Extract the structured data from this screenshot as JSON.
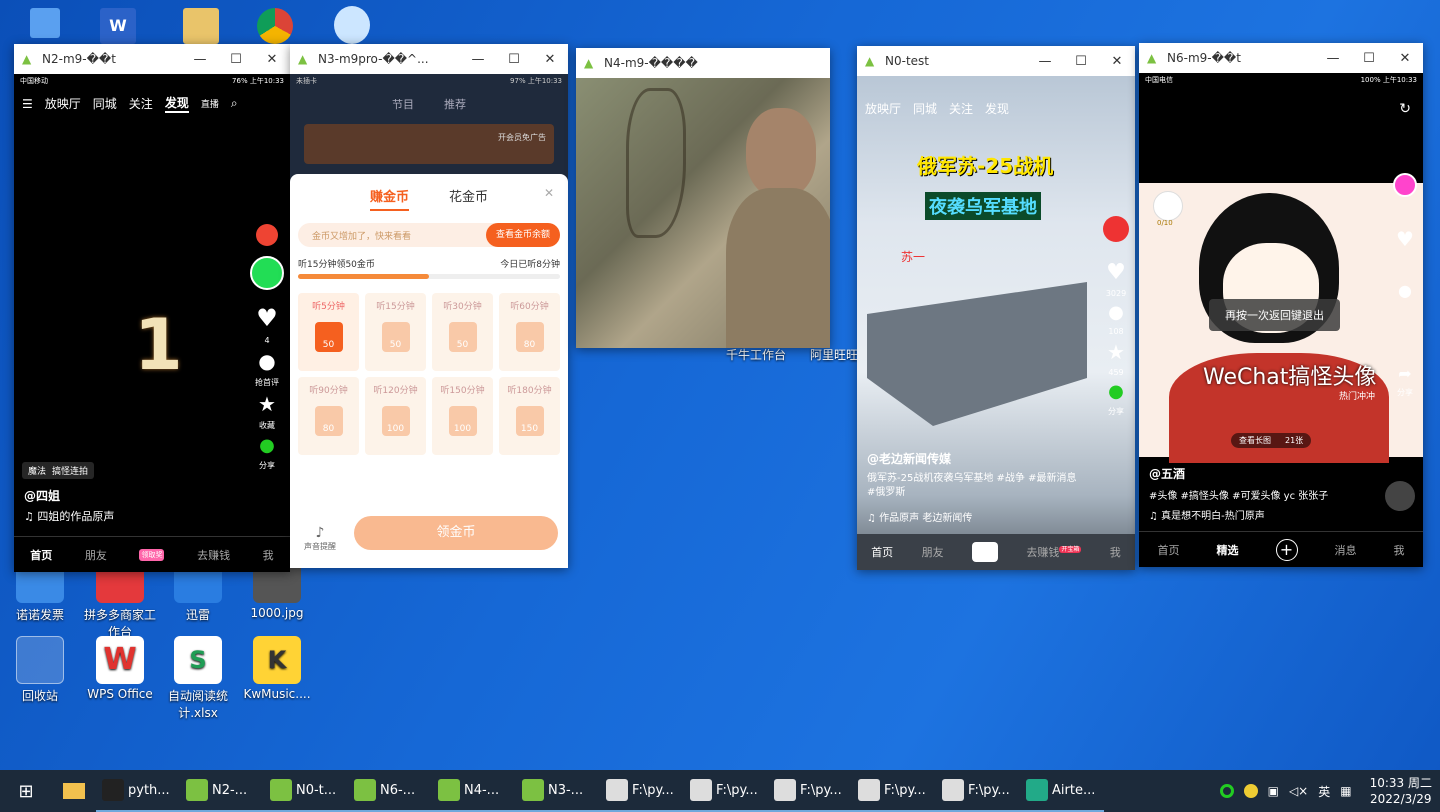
{
  "desktop": {
    "icons": [
      {
        "label": "诺诺发票"
      },
      {
        "label": "拼多多商家工作台"
      },
      {
        "label": "迅雷"
      },
      {
        "label": "1000.jpg"
      },
      {
        "label": "回收站"
      },
      {
        "label": "WPS Office"
      },
      {
        "label": "自动阅读统计.xlsx"
      },
      {
        "label": "KwMusic...."
      },
      {
        "label": "千牛工作台"
      },
      {
        "label": "阿里旺旺"
      }
    ]
  },
  "windows": {
    "n2": {
      "title": "N2-m9-��t",
      "status_left": "中国移动",
      "status_right": "76% 上午10:33",
      "nav": [
        "放映厅",
        "同城",
        "关注",
        "发现"
      ],
      "nav_live": "直播",
      "big_number": "1",
      "like_count": "4",
      "comment_label": "抢首评",
      "fav_label": "收藏",
      "share_label": "分享",
      "tag1": "魔法",
      "tag2": "搞怪连拍",
      "author": "@四姐",
      "music": "四姐的作品原声",
      "bottom_nav": [
        "首页",
        "朋友",
        "去赚钱",
        "我"
      ],
      "badge": "领取奖"
    },
    "n3": {
      "title": "N3-m9pro-��^...",
      "status_left": "未插卡",
      "status_right": "97% 上午10:33",
      "tabs": [
        "节目",
        "推荐"
      ],
      "ad_text": "开会员免广告",
      "sheet_tabs": [
        "赚金币",
        "花金币"
      ],
      "banner_text": "金币又增加了，快来看看",
      "banner_btn": "查看金币余额",
      "progress_left": "听15分钟领50金币",
      "progress_right": "今日已听8分钟",
      "progress_value": 0.5,
      "cells": [
        {
          "label": "听5分钟",
          "value": "50",
          "active": true
        },
        {
          "label": "听15分钟",
          "value": "50",
          "active": false
        },
        {
          "label": "听30分钟",
          "value": "50",
          "active": false
        },
        {
          "label": "听60分钟",
          "value": "80",
          "active": false
        },
        {
          "label": "听90分钟",
          "value": "80",
          "active": false
        },
        {
          "label": "听120分钟",
          "value": "100",
          "active": false
        },
        {
          "label": "听150分钟",
          "value": "100",
          "active": false
        },
        {
          "label": "听180分钟",
          "value": "150",
          "active": false
        }
      ],
      "remind_label": "声音提醒",
      "claim_btn": "领金币"
    },
    "n4": {
      "title": "N4-m9-����"
    },
    "n0": {
      "title": "N0-test",
      "nav": [
        "放映厅",
        "同城",
        "关注",
        "发现"
      ],
      "headline1": "俄军苏-25战机",
      "headline2": "夜袭乌军基地",
      "side_text": "苏一",
      "like_count": "3029",
      "comment_count": "108",
      "fav_count": "459",
      "share_label": "分享",
      "author": "@老边新闻传媒",
      "desc": "俄军苏-25战机夜袭乌军基地 #战争 #最新消息 #俄罗斯",
      "music": "作品原声   老边新闻传",
      "bottom_nav": [
        "首页",
        "朋友",
        "去赚钱",
        "我"
      ],
      "badge": "开宝箱"
    },
    "n6": {
      "title": "N6-m9-��t",
      "status_left": "中国电信",
      "status_right": "100% 上午10:33",
      "coin_text": "0/10",
      "toast": "再按一次返回键退出",
      "overlay": "WeChat搞怪头像",
      "overlay_sub": "热门冲冲",
      "longimg": "查看长图",
      "img_count": "21张",
      "share_label": "分享",
      "author": "@五酒",
      "desc": "#头像 #搞怪头像 #可爱头像 yc 张张子",
      "music": "真是想不明白-热门原声",
      "bottom_nav": [
        "首页",
        "精选",
        "消息",
        "我"
      ]
    }
  },
  "taskbar": {
    "items": [
      "pyth...",
      "N2-...",
      "N0-t...",
      "N6-...",
      "N4-...",
      "N3-...",
      "F:\\py...",
      "F:\\py...",
      "F:\\py...",
      "F:\\py...",
      "F:\\py...",
      "Airte..."
    ],
    "ime": "英",
    "time": "10:33 周二",
    "date": "2022/3/29"
  }
}
